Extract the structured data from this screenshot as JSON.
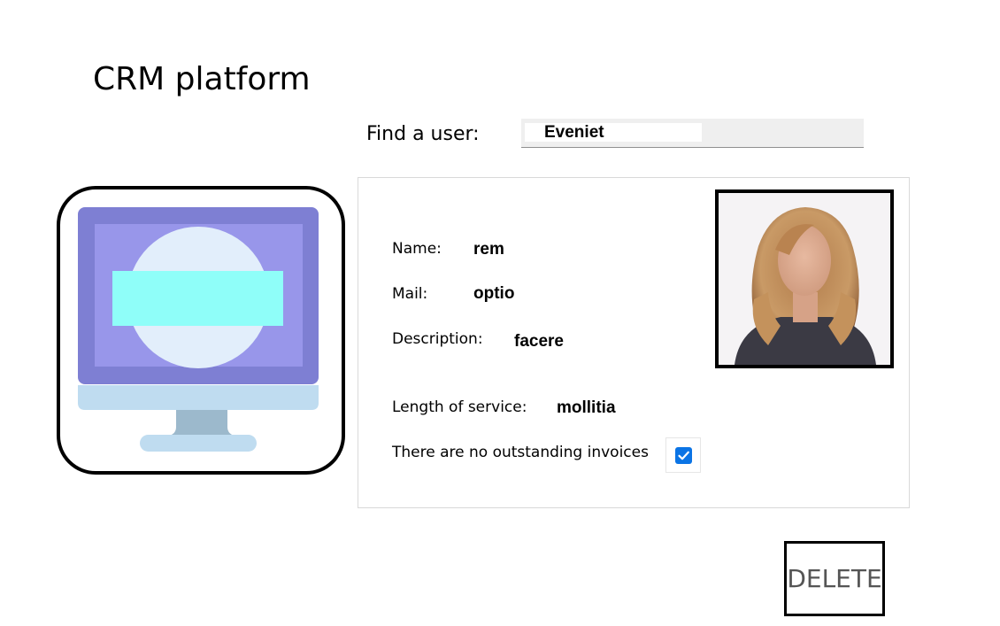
{
  "app": {
    "title": "CRM platform"
  },
  "search": {
    "label": "Find a user:",
    "value": "Eveniet"
  },
  "illustration": {
    "icon": "monitor-icon"
  },
  "user": {
    "name_label": "Name:",
    "name_value": "rem",
    "mail_label": "Mail:",
    "mail_value": "optio",
    "description_label": "Description:",
    "description_value": "facere",
    "service_label": "Length of service:",
    "service_value": "mollitia",
    "invoices_label": "There are no outstanding invoices",
    "invoices_checked": true,
    "photo": "user-photo"
  },
  "actions": {
    "delete_label": "DELETE"
  },
  "colors": {
    "accent": "#0b74e5",
    "search_bg": "#efefef",
    "monitor_outer": "#7e7fd3",
    "monitor_inner": "#9896ea",
    "monitor_circle": "#e2eefb",
    "monitor_bar": "#8ffef9",
    "monitor_base": "#bfdcf0",
    "monitor_stand": "#9cb9cc"
  }
}
